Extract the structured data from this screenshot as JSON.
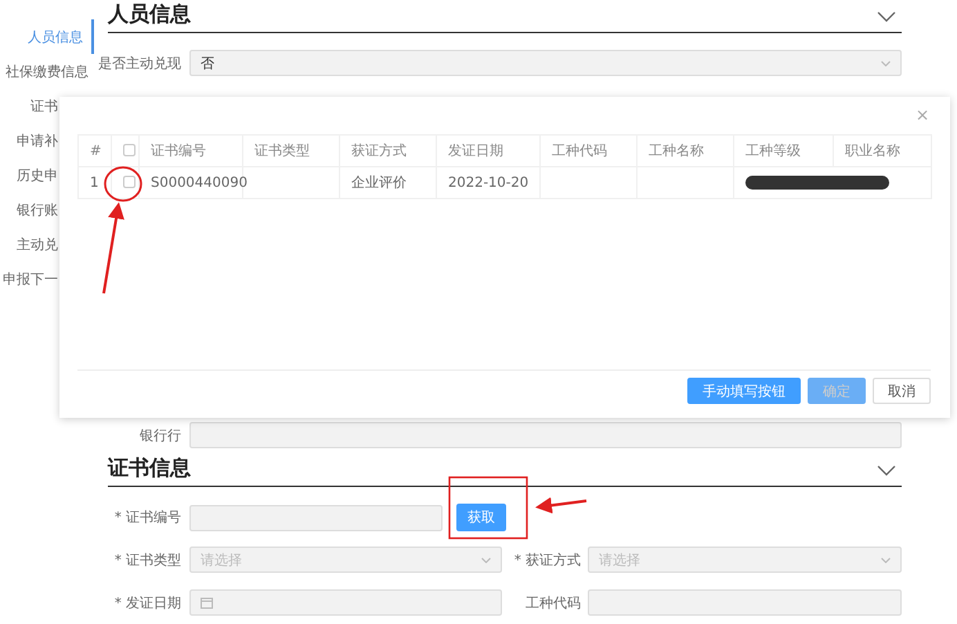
{
  "sidebar": {
    "items": [
      {
        "label": "人员信息",
        "selected": true,
        "cut": false
      },
      {
        "label": "社保缴费信息",
        "selected": false,
        "cut": false
      },
      {
        "label": "证书",
        "selected": false,
        "cut": true
      },
      {
        "label": "申请补",
        "selected": false,
        "cut": true
      },
      {
        "label": "历史申",
        "selected": false,
        "cut": true
      },
      {
        "label": "银行账",
        "selected": false,
        "cut": true
      },
      {
        "label": "主动兑",
        "selected": false,
        "cut": true
      },
      {
        "label": "申报下一",
        "selected": false,
        "cut": true
      }
    ]
  },
  "sections": [
    {
      "title": "人员信息",
      "rows": [
        {
          "kind": "wide",
          "fields": [
            {
              "label": "是否主动兑现",
              "kind": "select",
              "value": "否"
            }
          ]
        },
        {
          "kind": "under-dialog",
          "fields": [
            {
              "label": "银行行",
              "kind": "input"
            }
          ]
        }
      ]
    },
    {
      "title": "证书信息",
      "rows": [
        {
          "kind": "action",
          "fields": [
            {
              "label": "* 证书编号",
              "kind": "input",
              "button": "获取"
            }
          ]
        },
        {
          "kind": "pair",
          "fields": [
            {
              "label": "* 证书类型",
              "kind": "select",
              "placeholder": "请选择"
            },
            {
              "label": "* 获证方式",
              "kind": "select",
              "placeholder": "请选择"
            }
          ]
        },
        {
          "kind": "pair",
          "fields": [
            {
              "label": "* 发证日期",
              "kind": "date"
            },
            {
              "label": "工种代码",
              "kind": "input"
            }
          ]
        }
      ]
    }
  ],
  "dialog": {
    "close": "×",
    "columns": [
      {
        "kind": "text",
        "label": "#"
      },
      {
        "kind": "checkbox",
        "checked": false
      },
      {
        "kind": "text",
        "label": "证书编号"
      },
      {
        "kind": "text",
        "label": "证书类型"
      },
      {
        "kind": "text",
        "label": "获证方式"
      },
      {
        "kind": "text",
        "label": "发证日期"
      },
      {
        "kind": "text",
        "label": "工种代码"
      },
      {
        "kind": "text",
        "label": "工种名称"
      },
      {
        "kind": "text",
        "label": "工种等级"
      },
      {
        "kind": "text",
        "label": "职业名称"
      }
    ],
    "rows": [
      {
        "cells": [
          {
            "kind": "text",
            "text": "1"
          },
          {
            "kind": "checkbox",
            "checked": false
          },
          {
            "kind": "text",
            "text": "S0000440090"
          },
          {
            "kind": "text",
            "text": ""
          },
          {
            "kind": "text",
            "text": "企业评价"
          },
          {
            "kind": "text",
            "text": "2022-10-20"
          },
          {
            "kind": "text",
            "text": ""
          },
          {
            "kind": "text",
            "text": ""
          },
          {
            "kind": "redacted"
          }
        ]
      }
    ],
    "buttons": [
      {
        "label": "手动填写按钮",
        "kind": "primary",
        "disabled": false
      },
      {
        "label": "确定",
        "kind": "primary",
        "disabled": true
      },
      {
        "label": "取消",
        "kind": "default",
        "disabled": false
      }
    ]
  }
}
